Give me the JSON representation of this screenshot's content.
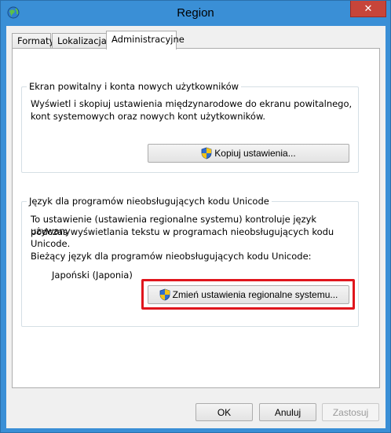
{
  "window": {
    "title": "Region",
    "close_label": "✕"
  },
  "tabs": [
    {
      "label": "Formaty"
    },
    {
      "label": "Lokalizacja"
    },
    {
      "label": "Administracyjne"
    }
  ],
  "welcome_group": {
    "legend": "Ekran powitalny i konta nowych użytkowników",
    "description_line1": "Wyświetl i skopiuj ustawienia międzynarodowe do ekranu powitalnego,",
    "description_line2": "kont systemowych oraz nowych kont użytkowników.",
    "copy_button": "Kopiuj ustawienia..."
  },
  "unicode_group": {
    "legend": "Język dla programów nieobsługujących kodu Unicode",
    "description_line1": "To ustawienie (ustawienia regionalne systemu) kontroluje język używany",
    "description_line2": "podczas wyświetlania tekstu w programach nieobsługujących kodu",
    "description_line3": "Unicode.",
    "current_label": "Bieżący język dla programów nieobsługujących kodu Unicode:",
    "current_value": "Japoński (Japonia)",
    "change_button": "Zmień ustawienia regionalne systemu..."
  },
  "footer": {
    "ok": "OK",
    "cancel": "Anuluj",
    "apply": "Zastosuj"
  },
  "colors": {
    "titlebar": "#3a8fd6",
    "highlight": "#e0161d"
  },
  "icons": [
    "globe-app-icon",
    "close-icon",
    "uac-shield-icon"
  ]
}
